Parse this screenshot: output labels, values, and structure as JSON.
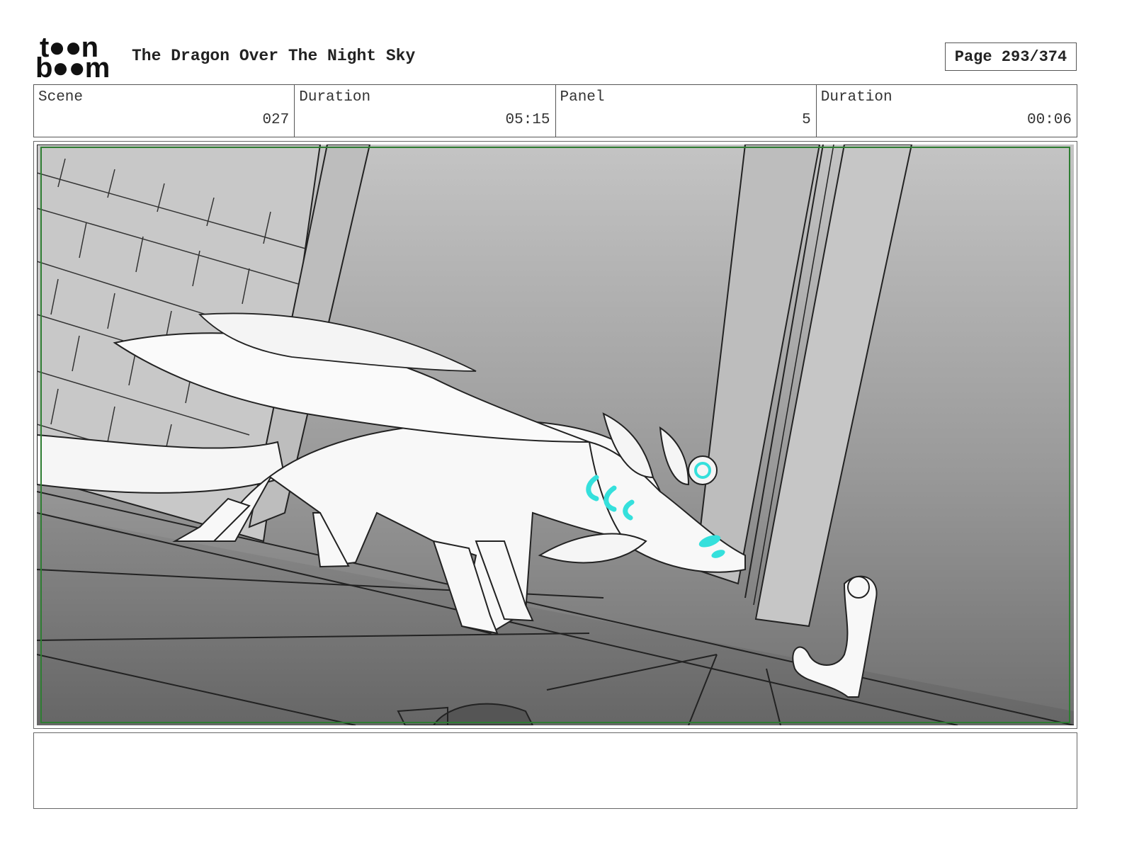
{
  "header": {
    "logo_line1": "t●●n",
    "logo_line2": "b●●m",
    "project_title": "The Dragon Over The Night Sky",
    "page_label": "Page 293/374"
  },
  "info": {
    "scene_label": "Scene",
    "scene_value": "027",
    "scene_duration_label": "Duration",
    "scene_duration_value": "05:15",
    "panel_label": "Panel",
    "panel_value": "5",
    "panel_duration_label": "Duration",
    "panel_duration_value": "00:06"
  },
  "panel": {
    "image_icon": "storyboard-sketch-dragon-alley",
    "safe_frame_color": "#2e7d32",
    "accent_color": "#35e0dc"
  },
  "notes": {
    "text": ""
  }
}
